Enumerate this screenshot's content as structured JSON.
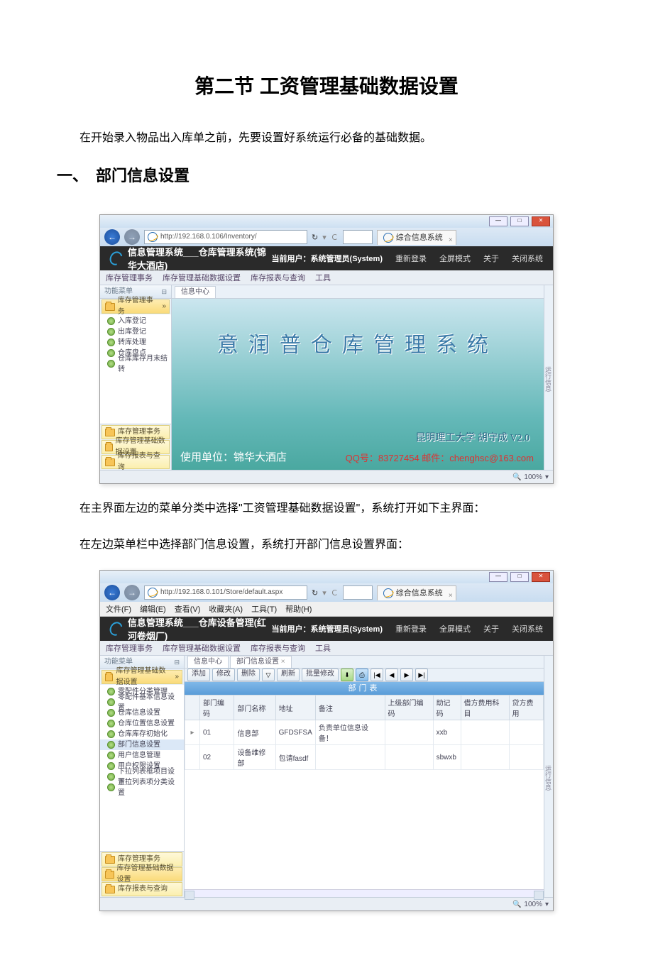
{
  "doc": {
    "title": "第二节 工资管理基础数据设置",
    "intro": "在开始录入物品出入库单之前，先要设置好系统运行必备的基础数据。",
    "section1_heading": "一、　部门信息设置",
    "para1": "在主界面左边的菜单分类中选择\"工资管理基础数据设置\"，系统打开如下主界面：",
    "para2": "在左边菜单栏中选择部门信息设置，系统打开部门信息设置界面："
  },
  "shot1": {
    "url": "http://192.168.0.106/Inventory/",
    "browser_tab": "综合信息系统",
    "app_title": "信息管理系统___仓库管理系统(锦华大酒店)",
    "user_label": "当前用户：系统管理员(System)",
    "header_links": [
      "重新登录",
      "全屏模式",
      "关于",
      "关闭系统"
    ],
    "menubar": [
      "库存管理事务",
      "库存管理基础数据设置",
      "库存报表与查询",
      "工具"
    ],
    "side_title": "功能菜单",
    "side_section_top": "库存管理事务",
    "side_items": [
      "入库登记",
      "出库登记",
      "转库处理",
      "仓库盘点",
      "仓库库存月末结转"
    ],
    "side_sections_bottom": [
      "库存管理事务",
      "库存管理基础数据设置",
      "库存报表与查询"
    ],
    "content_tab": "信息中心",
    "hero_title": "意润普仓库管理系统",
    "hero_sub": "昆明理工大学  胡守成    V2.0",
    "hero_unit": "使用单位：锦华大酒店",
    "hero_contact": "QQ号：83727454 邮件：chenghsc@163.com",
    "zoom": "100%"
  },
  "shot2": {
    "url": "http://192.168.0.101/Store/default.aspx",
    "browser_tab": "综合信息系统",
    "ie_menubar": [
      "文件(F)",
      "编辑(E)",
      "查看(V)",
      "收藏夹(A)",
      "工具(T)",
      "帮助(H)"
    ],
    "app_title": "信息管理系统___仓库设备管理(红河卷烟厂)",
    "user_label": "当前用户：系统管理员(System)",
    "header_links": [
      "重新登录",
      "全屏模式",
      "关于",
      "关闭系统"
    ],
    "menubar": [
      "库存管理事务",
      "库存管理基础数据设置",
      "库存报表与查询",
      "工具"
    ],
    "side_title": "功能菜单",
    "side_section_top": "库存管理基础数据设置",
    "side_items": [
      "零配件分类管理",
      "零配件基本信息设置",
      "仓库信息设置",
      "仓库位置信息设置",
      "仓库库存初始化",
      "部门信息设置",
      "用户信息管理",
      "用户权限设置",
      "下拉列表框项目设置",
      "下拉列表项分类设置"
    ],
    "side_items_selected_index": 5,
    "side_sections_bottom": [
      "库存管理事务",
      "库存管理基础数据设置",
      "库存报表与查询"
    ],
    "content_tabs": [
      "信息中心",
      "部门信息设置"
    ],
    "toolbar": [
      "添加",
      "修改",
      "删除",
      "刷新",
      "批量修改"
    ],
    "table_caption": "部门表",
    "columns": [
      "部门编码",
      "部门名称",
      "地址",
      "备注",
      "上级部门编码",
      "助记码",
      "借方费用科目",
      "贷方费用"
    ],
    "rows": [
      {
        "code": "01",
        "name": "信息部",
        "addr": "GFDSFSA",
        "note": "负责单位信息设备！",
        "parent": "",
        "mnemonic": "xxb",
        "debit": "",
        "credit": ""
      },
      {
        "code": "02",
        "name": "设备维修部",
        "addr": "包请fasdf",
        "note": "",
        "parent": "",
        "mnemonic": "sbwxb",
        "debit": "",
        "credit": ""
      }
    ],
    "zoom": "100%"
  },
  "vstrip_label": "运行信息"
}
